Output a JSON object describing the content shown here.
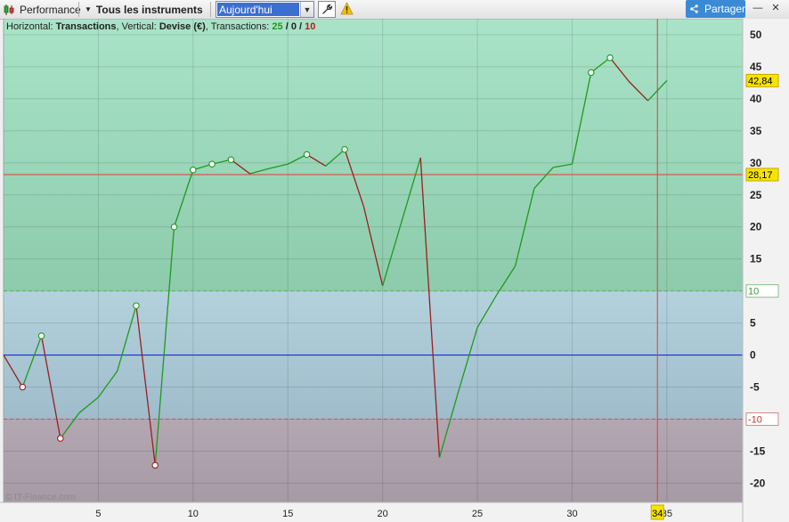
{
  "toolbar": {
    "performance_label": "Performance",
    "instruments_label": "Tous les instruments",
    "date_value": "Aujourd'hui",
    "share_label": "Partager",
    "minimize_glyph": "—",
    "close_glyph": "×"
  },
  "info": {
    "horizontal_prefix": "Horizontal:",
    "horizontal_value": "Transactions",
    "vertical_prefix": ", Vertical:",
    "vertical_value": "Devise (€)",
    "transactions_prefix": ", Transactions:",
    "count_win": "25",
    "slash1": " / ",
    "count_neutral": "0",
    "slash2": " / ",
    "count_loss": "10"
  },
  "watermark": "© IT-Finance.com",
  "colors": {
    "up": "#1e9a1e",
    "down": "#9a1e1e",
    "zero_line": "#1a2fd0",
    "marker_line": "#e03c3c",
    "marker_fill": "#f6e400",
    "zone_high": "#8fd3af",
    "zone_mid": "#abc8d3",
    "zone_low": "#b0a6b0"
  },
  "chart_data": {
    "type": "line",
    "xlim": [
      0,
      39
    ],
    "ylim": [
      -23,
      52.5
    ],
    "x_ticks": [
      5,
      10,
      15,
      20,
      25,
      30,
      35
    ],
    "y_ticks": [
      50,
      45,
      40,
      35,
      30,
      25,
      20,
      15,
      10,
      5,
      0,
      -5,
      -10,
      -15,
      -20
    ],
    "upper_threshold": 10,
    "lower_threshold": -10,
    "reference_level": 28.17,
    "reference_label": "28,17",
    "upper_threshold_label": "10",
    "lower_threshold_label": "-10",
    "crosshair_x": 34.5,
    "crosshair_label": "34",
    "last_value": 42.84,
    "last_value_label": "42,84",
    "points": [
      {
        "x": 0,
        "y": 0,
        "m": false
      },
      {
        "x": 1,
        "y": -5,
        "m": true
      },
      {
        "x": 2,
        "y": 3,
        "m": true
      },
      {
        "x": 3,
        "y": -13,
        "m": true
      },
      {
        "x": 4,
        "y": -9,
        "m": false
      },
      {
        "x": 5,
        "y": -6.6,
        "m": false
      },
      {
        "x": 6,
        "y": -2.5,
        "m": false
      },
      {
        "x": 7,
        "y": 7.7,
        "m": true
      },
      {
        "x": 8,
        "y": -17.2,
        "m": true
      },
      {
        "x": 9,
        "y": 20,
        "m": true
      },
      {
        "x": 10,
        "y": 28.9,
        "m": true
      },
      {
        "x": 11,
        "y": 29.8,
        "m": true
      },
      {
        "x": 12,
        "y": 30.5,
        "m": true
      },
      {
        "x": 13,
        "y": 28.3,
        "m": false
      },
      {
        "x": 14,
        "y": 29.1,
        "m": false
      },
      {
        "x": 15,
        "y": 29.8,
        "m": false
      },
      {
        "x": 16,
        "y": 31.3,
        "m": true
      },
      {
        "x": 17,
        "y": 29.5,
        "m": false
      },
      {
        "x": 18,
        "y": 32.1,
        "m": true
      },
      {
        "x": 19,
        "y": 23.2,
        "m": false
      },
      {
        "x": 20,
        "y": 10.8,
        "m": false
      },
      {
        "x": 22,
        "y": 30.8,
        "m": false
      },
      {
        "x": 23,
        "y": -16,
        "m": false
      },
      {
        "x": 24,
        "y": -5.7,
        "m": false
      },
      {
        "x": 25,
        "y": 4.3,
        "m": false
      },
      {
        "x": 26,
        "y": 9.3,
        "m": false
      },
      {
        "x": 27,
        "y": 13.9,
        "m": false
      },
      {
        "x": 28,
        "y": 26,
        "m": false
      },
      {
        "x": 29,
        "y": 29.3,
        "m": false
      },
      {
        "x": 30,
        "y": 29.8,
        "m": false
      },
      {
        "x": 31,
        "y": 44.1,
        "m": true
      },
      {
        "x": 32,
        "y": 46.4,
        "m": true
      },
      {
        "x": 33,
        "y": 42.7,
        "m": false
      },
      {
        "x": 34,
        "y": 39.7,
        "m": false
      },
      {
        "x": 35,
        "y": 42.84,
        "m": false
      }
    ]
  }
}
